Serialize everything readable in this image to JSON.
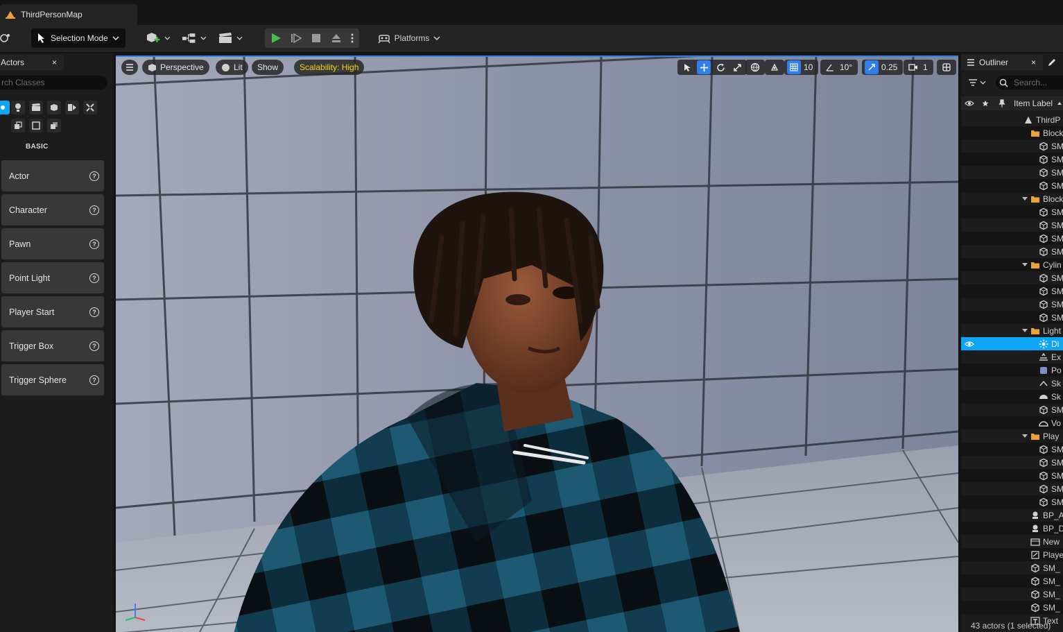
{
  "document_tab": {
    "title": "ThirdPersonMap"
  },
  "toolbar": {
    "selection_mode": "Selection Mode",
    "platforms": "Platforms"
  },
  "place_actors": {
    "tab_label": "Actors",
    "close": "×",
    "search_placeholder": "rch Classes",
    "category": "BASIC",
    "items": [
      {
        "label": "Actor"
      },
      {
        "label": "Character"
      },
      {
        "label": "Pawn"
      },
      {
        "label": "Point Light"
      },
      {
        "label": "Player Start"
      },
      {
        "label": "Trigger Box"
      },
      {
        "label": "Trigger Sphere"
      }
    ]
  },
  "viewport": {
    "perspective": "Perspective",
    "lit": "Lit",
    "show": "Show",
    "scalability": "Scalability: High",
    "grid_snap": "10",
    "rotation_snap": "10°",
    "scale_snap": "0.25",
    "camera_speed": "1",
    "colors": {
      "accent": "#2f80ed",
      "scalability": "#f7d70c"
    }
  },
  "outliner": {
    "tab_label": "Outliner",
    "close": "×",
    "search_placeholder": "Search...",
    "column_label": "Item Label",
    "footer": "43 actors (1 selected)",
    "rows": [
      {
        "label": "ThirdP"
      },
      {
        "label": "Block"
      },
      {
        "label": "SM"
      },
      {
        "label": "SM"
      },
      {
        "label": "SM"
      },
      {
        "label": "SM"
      },
      {
        "label": "Block"
      },
      {
        "label": "SM"
      },
      {
        "label": "SM"
      },
      {
        "label": "SM"
      },
      {
        "label": "SM"
      },
      {
        "label": "Cylin"
      },
      {
        "label": "SM"
      },
      {
        "label": "SM"
      },
      {
        "label": "SM"
      },
      {
        "label": "SM"
      },
      {
        "label": "Light"
      },
      {
        "label": "Di"
      },
      {
        "label": "Ex"
      },
      {
        "label": "Po"
      },
      {
        "label": "Sk"
      },
      {
        "label": "Sk"
      },
      {
        "label": "SM"
      },
      {
        "label": "Vo"
      },
      {
        "label": "Play"
      },
      {
        "label": "SM"
      },
      {
        "label": "SM"
      },
      {
        "label": "SM"
      },
      {
        "label": "SM"
      },
      {
        "label": "SM"
      },
      {
        "label": "BP_A"
      },
      {
        "label": "BP_D"
      },
      {
        "label": "New"
      },
      {
        "label": "Playe"
      },
      {
        "label": "SM_"
      },
      {
        "label": "SM_"
      },
      {
        "label": "SM_"
      },
      {
        "label": "SM_"
      },
      {
        "label": "Text"
      }
    ],
    "colors": {
      "selected": "#0ea5f5"
    }
  }
}
